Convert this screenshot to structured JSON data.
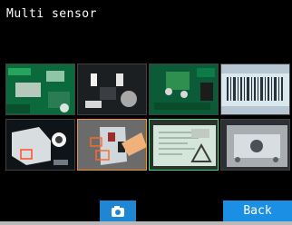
{
  "screen": {
    "title": "Multi sensor"
  },
  "tiles": [
    {
      "name": "green-pcb-1",
      "row": 1,
      "col": 1,
      "highlight": "none"
    },
    {
      "name": "dark-electronics",
      "row": 1,
      "col": 2,
      "highlight": "none"
    },
    {
      "name": "green-pcb-2",
      "row": 1,
      "col": 3,
      "highlight": "none"
    },
    {
      "name": "barcode",
      "row": 1,
      "col": 4,
      "highlight": "none"
    },
    {
      "name": "white-part",
      "row": 2,
      "col": 1,
      "highlight": "none"
    },
    {
      "name": "hand-part",
      "row": 2,
      "col": 2,
      "highlight": "orange"
    },
    {
      "name": "printed-label",
      "row": 2,
      "col": 3,
      "highlight": "green"
    },
    {
      "name": "metal-component",
      "row": 2,
      "col": 4,
      "highlight": "none"
    }
  ],
  "buttons": {
    "camera": {
      "icon": "camera-icon"
    },
    "back": {
      "label": "Back"
    }
  },
  "colors": {
    "button_blue": "#1b8fe3",
    "highlight_orange": "#ff8a2b",
    "highlight_green": "#3adf88"
  }
}
